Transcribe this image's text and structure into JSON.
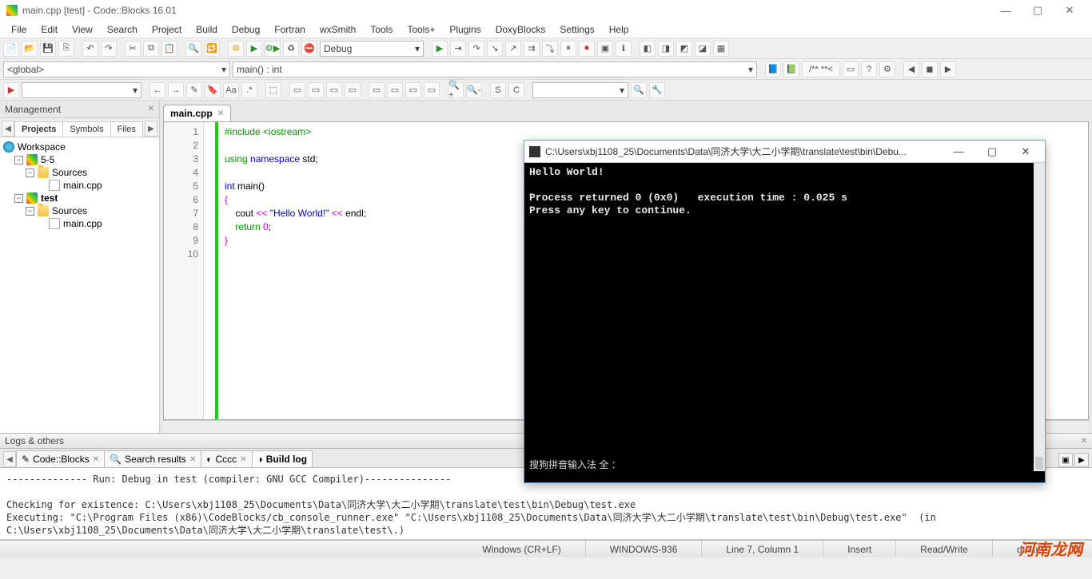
{
  "window": {
    "title": "main.cpp [test] - Code::Blocks 16.01",
    "min": "—",
    "max": "▢",
    "close": "✕"
  },
  "menu": [
    "File",
    "Edit",
    "View",
    "Search",
    "Project",
    "Build",
    "Debug",
    "Fortran",
    "wxSmith",
    "Tools",
    "Tools+",
    "Plugins",
    "DoxyBlocks",
    "Settings",
    "Help"
  ],
  "toolbar1_combo": "Debug",
  "scope_combo_left": "<global>",
  "scope_combo_right": "main() : int",
  "comment_btn": "/** **<",
  "toolbar3_letters": [
    "Aa",
    ".*",
    "S",
    "C"
  ],
  "mgmt": {
    "title": "Management",
    "tabs": [
      "Projects",
      "Symbols",
      "Files"
    ],
    "tree": {
      "workspace": "Workspace",
      "proj1": "5-5",
      "proj1_folder": "Sources",
      "proj1_file": "main.cpp",
      "proj2": "test",
      "proj2_folder": "Sources",
      "proj2_file": "main.cpp"
    }
  },
  "editor": {
    "tab": "main.cpp",
    "lines": [
      "1",
      "2",
      "3",
      "4",
      "5",
      "6",
      "7",
      "8",
      "9",
      "10"
    ],
    "code": {
      "l1a": "#include ",
      "l1b": "<iostream>",
      "l3a": "using ",
      "l3b": "namespace ",
      "l3c": "std",
      "l3d": ";",
      "l5a": "int ",
      "l5b": "main",
      "l5c": "()",
      "l6": "{",
      "l7a": "    cout ",
      "l7b": "<< ",
      "l7c": "\"Hello World!\"",
      "l7d": " << ",
      "l7e": "endl",
      "l7f": ";",
      "l8a": "    ",
      "l8b": "return ",
      "l8c": "0",
      "l8d": ";",
      "l9": "}"
    }
  },
  "logs": {
    "title": "Logs & others",
    "tabs": [
      "Code::Blocks",
      "Search results",
      "Cccc",
      "Build log"
    ],
    "body": "-------------- Run: Debug in test (compiler: GNU GCC Compiler)---------------\n\nChecking for existence: C:\\Users\\xbj1108_25\\Documents\\Data\\同济大学\\大二小学期\\translate\\test\\bin\\Debug\\test.exe\nExecuting: \"C:\\Program Files (x86)\\CodeBlocks/cb_console_runner.exe\" \"C:\\Users\\xbj1108_25\\Documents\\Data\\同济大学\\大二小学期\\translate\\test\\bin\\Debug\\test.exe\"  (in C:\\Users\\xbj1108_25\\Documents\\Data\\同济大学\\大二小学期\\translate\\test\\.)"
  },
  "status": {
    "eol": "Windows (CR+LF)",
    "enc": "WINDOWS-936",
    "pos": "Line 7, Column 1",
    "ins": "Insert",
    "rw": "Read/Write",
    "mod": "default"
  },
  "console": {
    "title": "C:\\Users\\xbj1108_25\\Documents\\Data\\同济大学\\大二小学期\\translate\\test\\bin\\Debu...",
    "body": "Hello World!\n\nProcess returned 0 (0x0)   execution time : 0.025 s\nPress any key to continue.",
    "ime": "搜狗拼音输入法  全 ："
  },
  "watermark": "河南龙网"
}
